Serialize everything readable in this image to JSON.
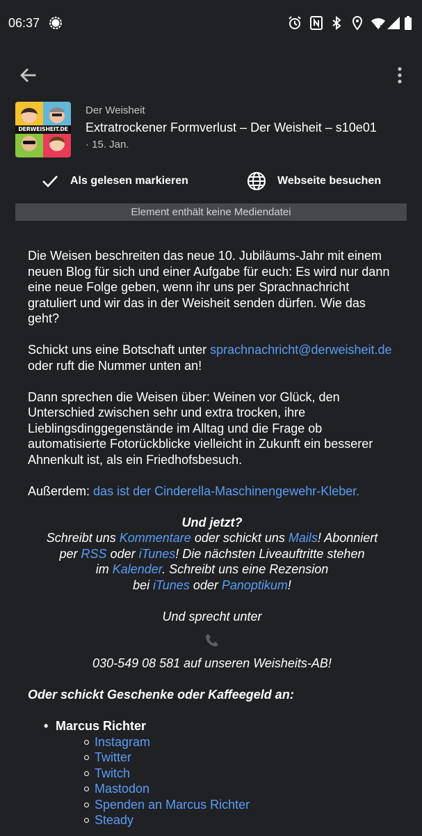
{
  "status_bar": {
    "time": "06:37",
    "icons": [
      "signal-messenger-icon",
      "alarm-icon",
      "nfc-icon",
      "bluetooth-icon",
      "location-icon",
      "wifi-icon",
      "cell-signal-icon",
      "battery-icon"
    ]
  },
  "app_bar": {
    "icons": [
      "back-arrow-icon",
      "more-vert-icon"
    ]
  },
  "episode": {
    "podcast_name": "Der Weisheit",
    "title": "Extratrockener Formverlust – Der Weisheit – s10e01",
    "date": "· 15. Jan.",
    "cover_text": "DERWEISHEIT.DE"
  },
  "actions": {
    "mark_read": "Als gelesen markieren",
    "visit_website": "Webseite besuchen"
  },
  "media_banner": "Element enthält keine Mediendatei",
  "description": {
    "p1": "Die Weisen beschreiten das neue 10. Jubiläums-Jahr mit einem neuen Blog für sich und  einer Aufgabe für euch: Es wird nur dann eine neue Folge geben, wenn ihr uns per Sprachnachricht gratuliert und wir das in der Weisheit senden dürfen. Wie das geht?",
    "p2_before": "Schickt uns eine Botschaft unter ",
    "p2_link": "sprachnachricht@derweisheit.de",
    "p2_after": " oder ruft die Nummer unten an!",
    "p3": "Dann sprechen die Weisen über: Weinen vor Glück, den Unterschied zwischen sehr und extra trocken, ihre Lieblingsdinggegenstände im Alltag und die Frage ob automatisierte Fotorückblicke vielleicht in Zukunft ein besserer Ahnenkult ist, als ein Friedhofsbesuch.",
    "p4_before": "Außerdem: ",
    "p4_link": "das ist der Cinderella-Maschinengewehr-Kleber."
  },
  "centered": {
    "heading": "Und jetzt?",
    "l1_a": "Schreibt uns ",
    "l1_link1": "Kommentare",
    "l1_b": " oder schickt uns ",
    "l1_link2": "Mails",
    "l1_c": "! Abonniert",
    "l2_a": "per ",
    "l2_link1": "RSS",
    "l2_b": " oder ",
    "l2_link2": "iTunes",
    "l2_c": "! Die nächsten Liveauftritte stehen",
    "l3_a": "im ",
    "l3_link": "Kalender",
    "l3_b": ". Schreibt uns eine Rezension",
    "l4_a": "bei ",
    "l4_link1": "iTunes",
    "l4_b": " oder ",
    "l4_link2": "Panoptikum",
    "l4_c": "!",
    "speak": "Und sprecht unter",
    "phone_line": "030-549 08 581 auf unseren Weisheits-AB!"
  },
  "gifts_heading": "Oder schickt Geschenke oder Kaffeegeld an:",
  "person": {
    "name": "Marcus Richter",
    "links": [
      "Instagram",
      "Twitter",
      "Twitch",
      "Mastodon",
      "Spenden an Marcus Richter",
      "Steady"
    ]
  }
}
